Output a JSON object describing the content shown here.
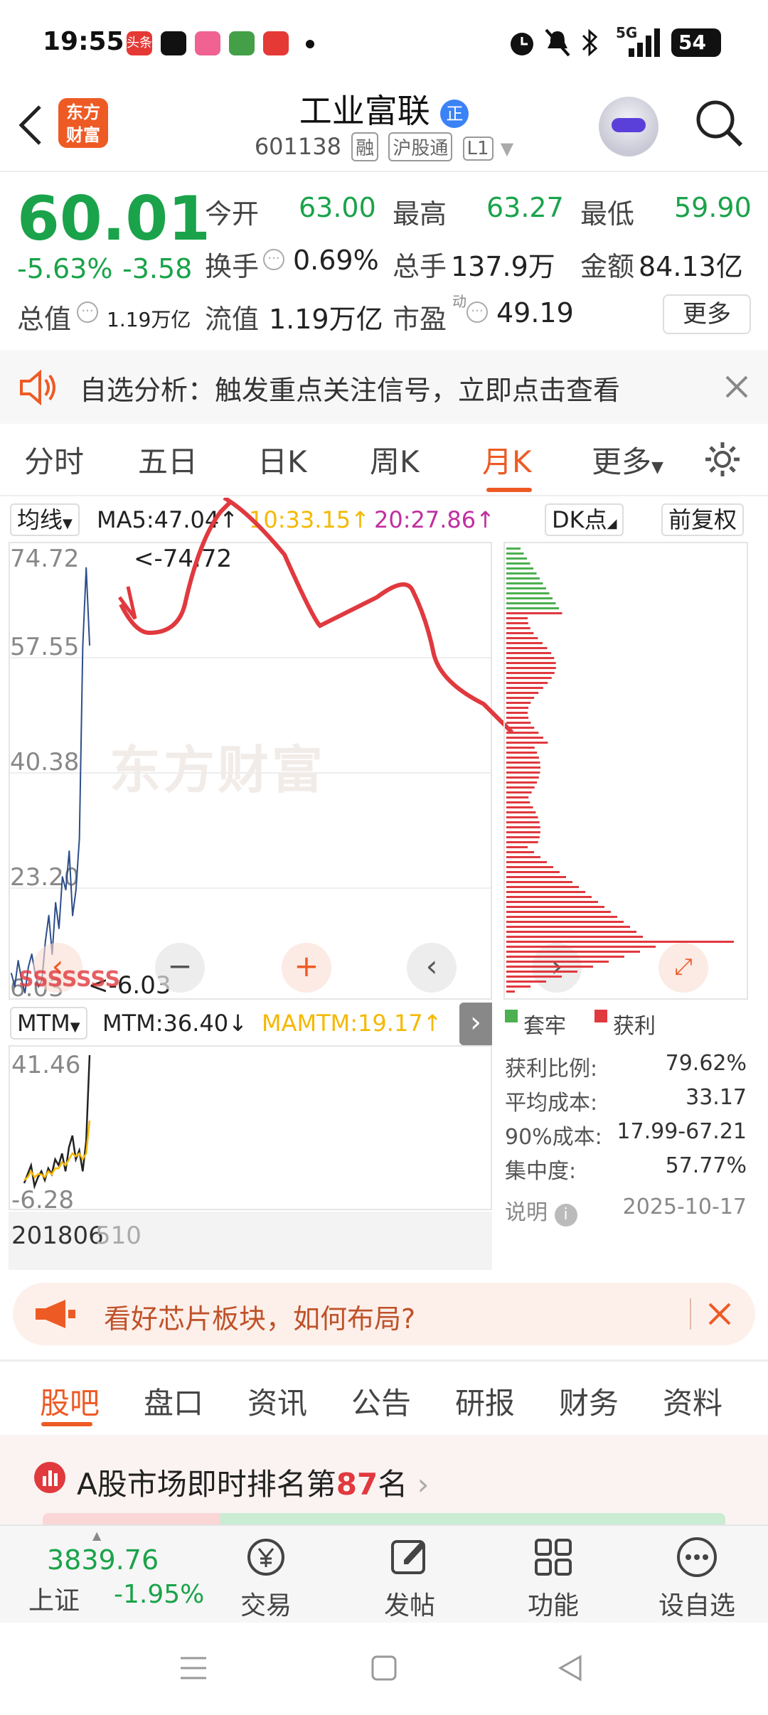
{
  "status_bar": {
    "time": "19:55",
    "notif_icons": [
      "头条",
      "tiktok-icon",
      "bilibili-icon",
      "message-icon",
      "wallet-icon"
    ],
    "network": "5G",
    "battery": "54"
  },
  "header": {
    "logo_line1": "东方",
    "logo_line2": "财富",
    "title": "工业富联",
    "title_badge": "正",
    "code": "601138",
    "tags": [
      "融",
      "沪股通",
      "L1"
    ]
  },
  "quote": {
    "price": "60.01",
    "change_pct": "-5.63%",
    "change_abs": "-3.58",
    "open_label": "今开",
    "open": "63.00",
    "high_label": "最高",
    "high": "63.27",
    "low_label": "最低",
    "low": "59.90",
    "turnover_label": "换手",
    "turnover": "0.69%",
    "volume_label": "总手",
    "volume": "137.9万",
    "amount_label": "金额",
    "amount": "84.13亿",
    "mktcap_label": "总值",
    "mktcap": "1.19万亿",
    "float_label": "流值",
    "float": "1.19万亿",
    "pe_label": "市盈",
    "pe_sup": "动",
    "pe": "49.19",
    "more": "更多"
  },
  "notice": {
    "text": "自选分析：触发重点关注信号，立即点击查看"
  },
  "chart_tabs": [
    "分时",
    "五日",
    "日K",
    "周K",
    "月K",
    "更多"
  ],
  "chart_controls": {
    "ma_select": "均线",
    "ma5": "MA5:47.04↑",
    "ma10": "10:33.15↑",
    "ma20": "20:27.86↑",
    "dk": "DK点",
    "adjust": "前复权",
    "y_ticks": [
      "74.72",
      "57.55",
      "40.38",
      "23.20",
      "6.03"
    ],
    "max_label": "<-74.72",
    "min_label": "<-6.03",
    "watermark": "东方财富",
    "mtm_select": "MTM",
    "mtm": "MTM:36.40↓",
    "mamtm": "MAMTM:19.17↑",
    "mtm_ticks": [
      "41.46",
      "-6.28"
    ],
    "x_start": "201806",
    "x_end": "510"
  },
  "chart_data": {
    "type": "line",
    "title": "",
    "ylim": [
      6.03,
      74.72
    ],
    "series": [
      {
        "name": "",
        "values": [
          9,
          7,
          11,
          8,
          6,
          10,
          12,
          9,
          7,
          8,
          14,
          18,
          12,
          20,
          16,
          24,
          22,
          28,
          18,
          22,
          30,
          60,
          72,
          60
        ]
      }
    ],
    "mtm_ylim": [
      -6.28,
      41.46
    ],
    "mtm_series": [
      {
        "name": "MTM",
        "values": [
          -2,
          1,
          4,
          -3,
          0,
          2,
          -1,
          3,
          1,
          6,
          4,
          8,
          2,
          10,
          14,
          6,
          9,
          2,
          12,
          41
        ]
      },
      {
        "name": "MAMTM",
        "values": [
          -1,
          0,
          2,
          0,
          1,
          1,
          0,
          2,
          1,
          3,
          3,
          5,
          4,
          6,
          8,
          7,
          8,
          6,
          8,
          19
        ]
      }
    ]
  },
  "chip_stats": {
    "legend_trap": "套牢",
    "legend_profit": "获利",
    "profit_ratio_label": "获利比例:",
    "profit_ratio": "79.62%",
    "avg_cost_label": "平均成本:",
    "avg_cost": "33.17",
    "cost90_label": "90%成本:",
    "cost90": "17.99-67.21",
    "concentration_label": "集中度:",
    "concentration": "57.77%",
    "note_label": "说明",
    "date": "2025-10-17"
  },
  "banner": {
    "text": "看好芯片板块，如何布局?"
  },
  "bottom_tabs": [
    "股吧",
    "盘口",
    "资讯",
    "公告",
    "研报",
    "财务",
    "资料"
  ],
  "rank": {
    "prefix": "A股市场即时排名第",
    "num": "87",
    "suffix": "名"
  },
  "bottom_nav": {
    "index_value": "3839.76",
    "index_name": "上证",
    "index_change": "-1.95%",
    "trade": "交易",
    "post": "发帖",
    "func": "功能",
    "watch": "设自选"
  },
  "colors": {
    "accent": "#ee5a24",
    "down": "#1aa34a",
    "up": "#e0393e"
  }
}
